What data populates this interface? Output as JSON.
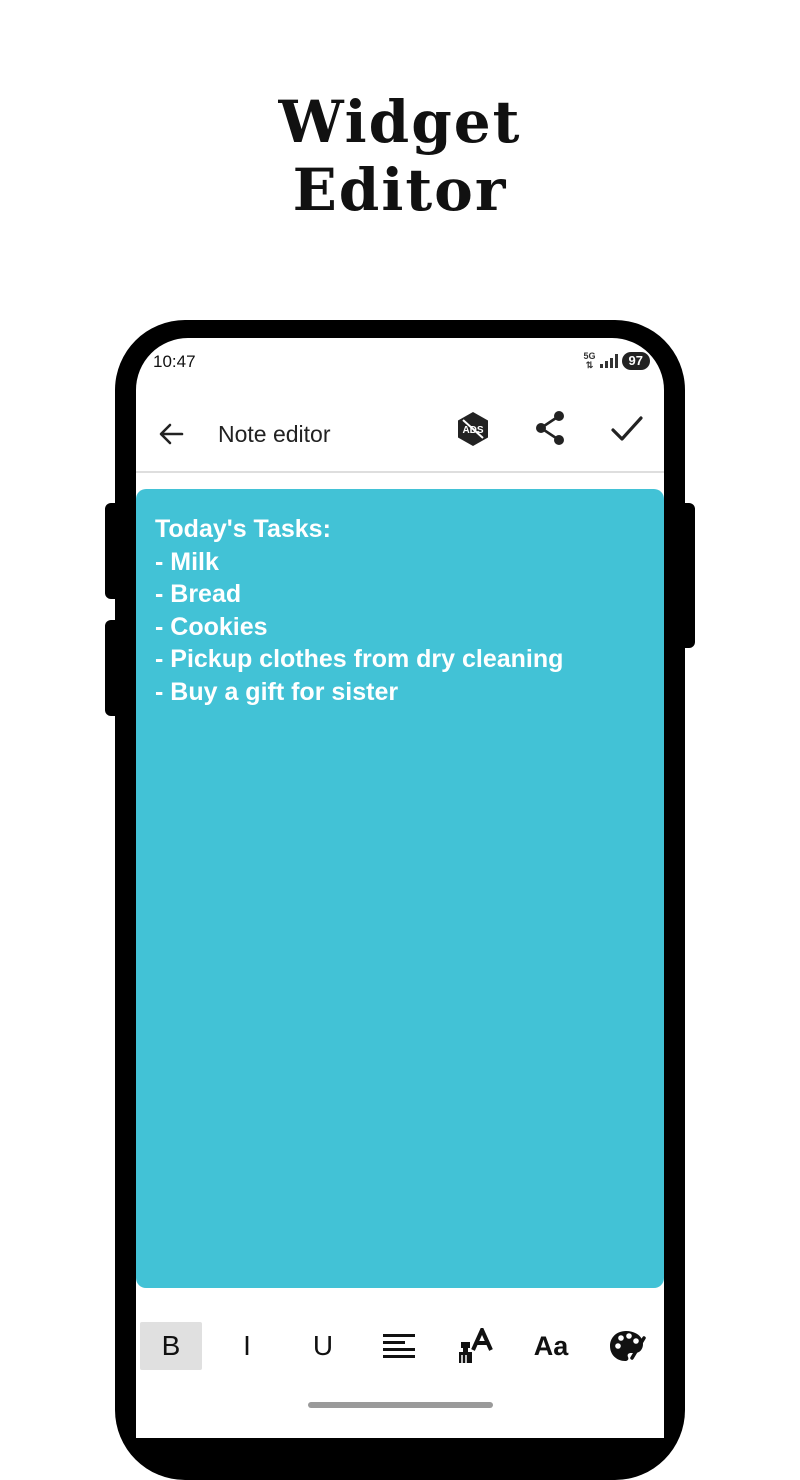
{
  "promo": {
    "line1": "Widget",
    "line2": "Editor"
  },
  "status_bar": {
    "time": "10:47",
    "network": "5G",
    "battery": "97"
  },
  "app_bar": {
    "title": "Note editor",
    "back_icon": "arrow-left-icon",
    "ads_icon": "remove-ads-icon",
    "ads_label": "ADS",
    "share_icon": "share-icon",
    "save_icon": "checkmark-icon"
  },
  "note": {
    "background": "#42c2d6",
    "text_color": "#ffffff",
    "content": "Today's Tasks:\n- Milk\n- Bread\n- Cookies\n- Pickup clothes from dry cleaning\n- Buy a gift for sister"
  },
  "toolbar": {
    "bold": "B",
    "italic": "I",
    "underline": "U",
    "font_size": "Aa",
    "active_tool": "bold",
    "icons": [
      "align-left-icon",
      "text-color-icon",
      "font-size-icon",
      "palette-icon"
    ]
  }
}
